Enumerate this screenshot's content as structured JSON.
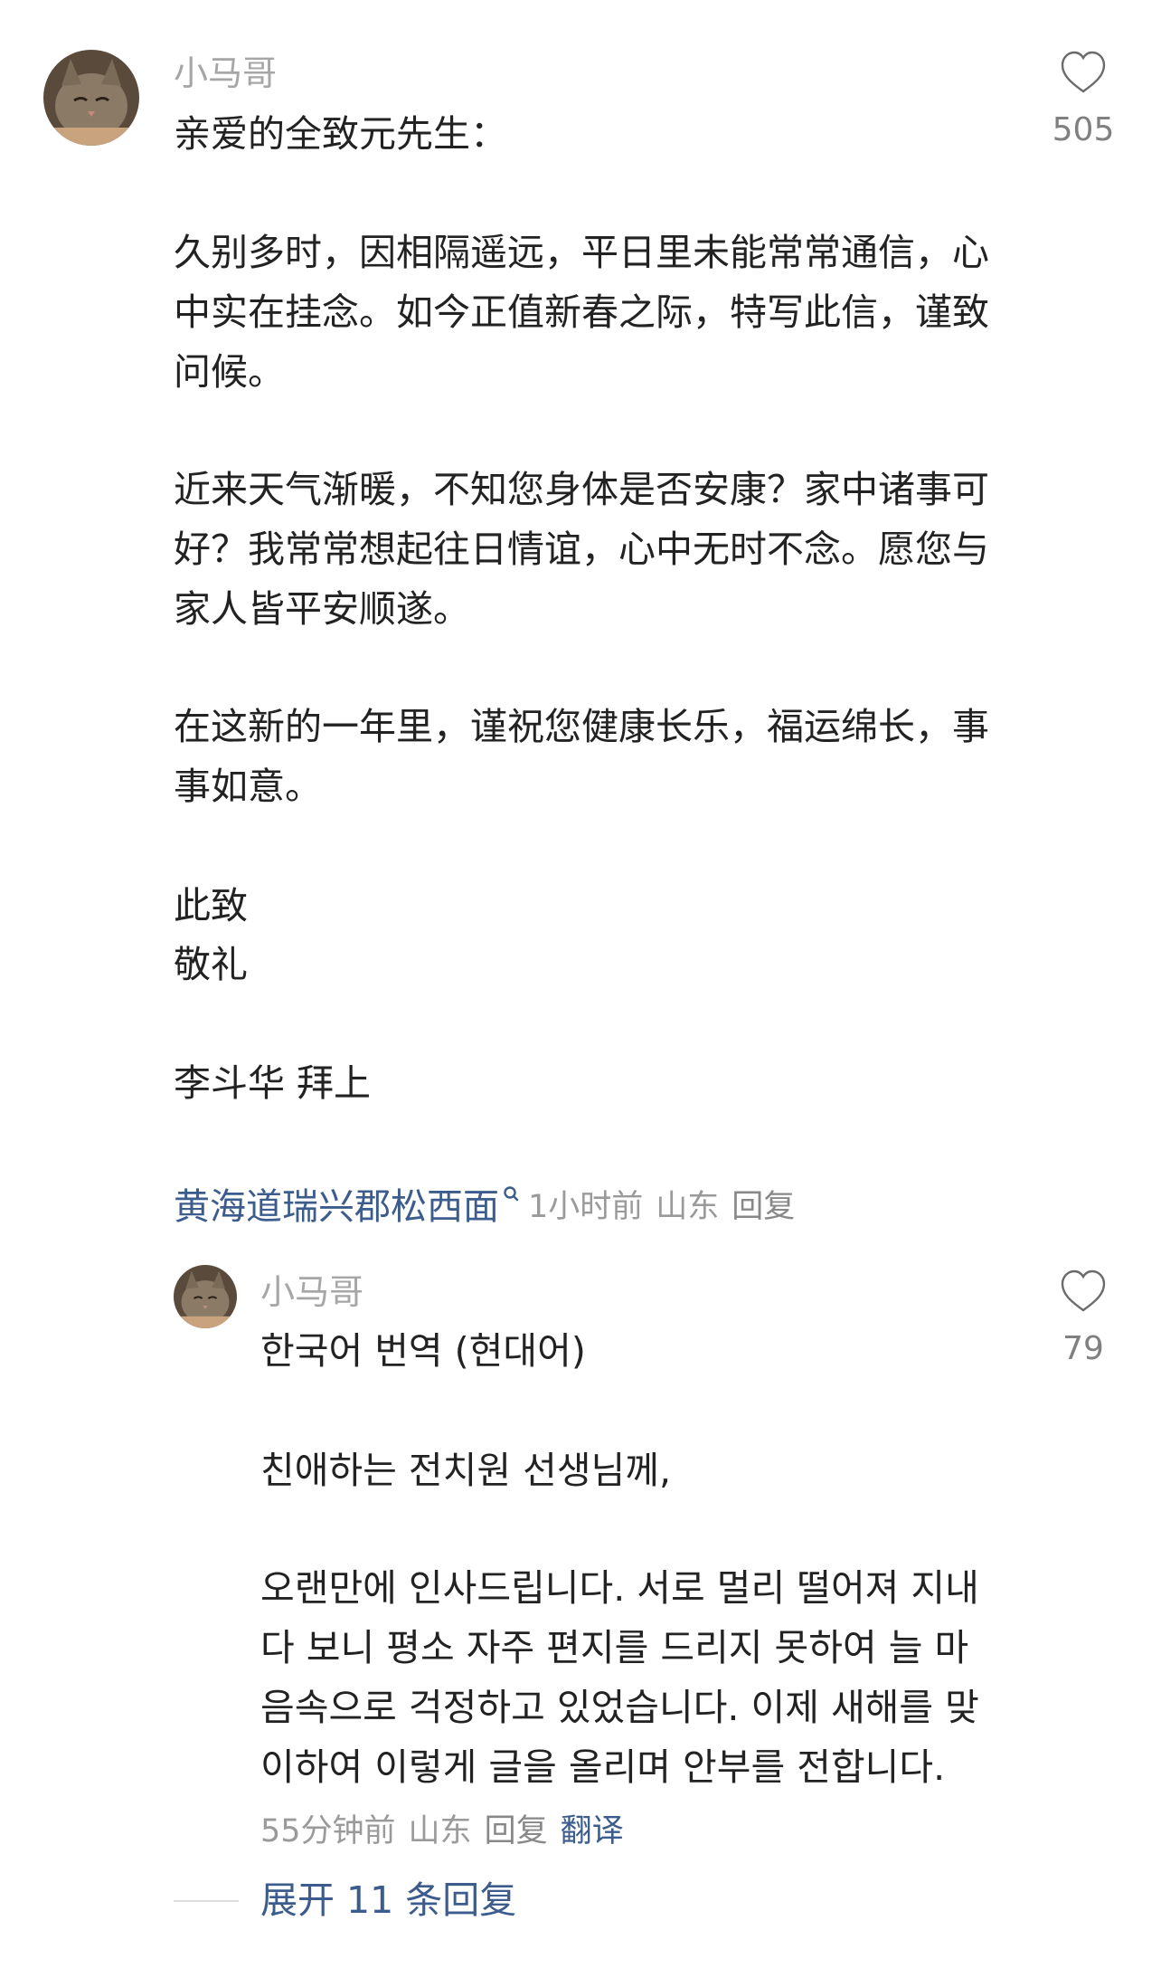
{
  "main_comment": {
    "username": "小马哥",
    "greeting": "亲爱的全致元先生：",
    "paragraph1": "久别多时，因相隔遥远，平日里未能常常通信，心中实在挂念。如今正值新春之际，特写此信，谨致问候。",
    "paragraph2": "近来天气渐暖，不知您身体是否安康？家中诸事可好？我常常想起往日情谊，心中无时不念。愿您与家人皆平安顺遂。",
    "paragraph3": "在这新的一年里，谨祝您健康长乐，福运绵长，事事如意。",
    "closing1": "此致",
    "closing2": "敬礼",
    "signature": "李斗华 拜上",
    "like_count": "505",
    "location_tag": "黄海道瑞兴郡松西面",
    "time": "1小时前",
    "region": "山东",
    "reply_label": "回复"
  },
  "reply_comment": {
    "username": "小马哥",
    "heading": "한국어 번역 (현대어)",
    "greeting": "친애하는 전치원 선생님께,",
    "paragraph1": "오랜만에 인사드립니다. 서로 멀리 떨어져 지내다 보니 평소 자주 편지를 드리지 못하여 늘 마음속으로 걱정하고 있었습니다. 이제 새해를 맞이하여 이렇게 글을 올리며 안부를 전합니다.",
    "like_count": "79",
    "time": "55分钟前",
    "region": "山东",
    "reply_label": "回复",
    "translate_label": "翻译"
  },
  "expand_replies": {
    "label": "展开 11 条回复"
  },
  "icons": {
    "like": "heart-outline-icon",
    "location": "location-pin-icon"
  }
}
